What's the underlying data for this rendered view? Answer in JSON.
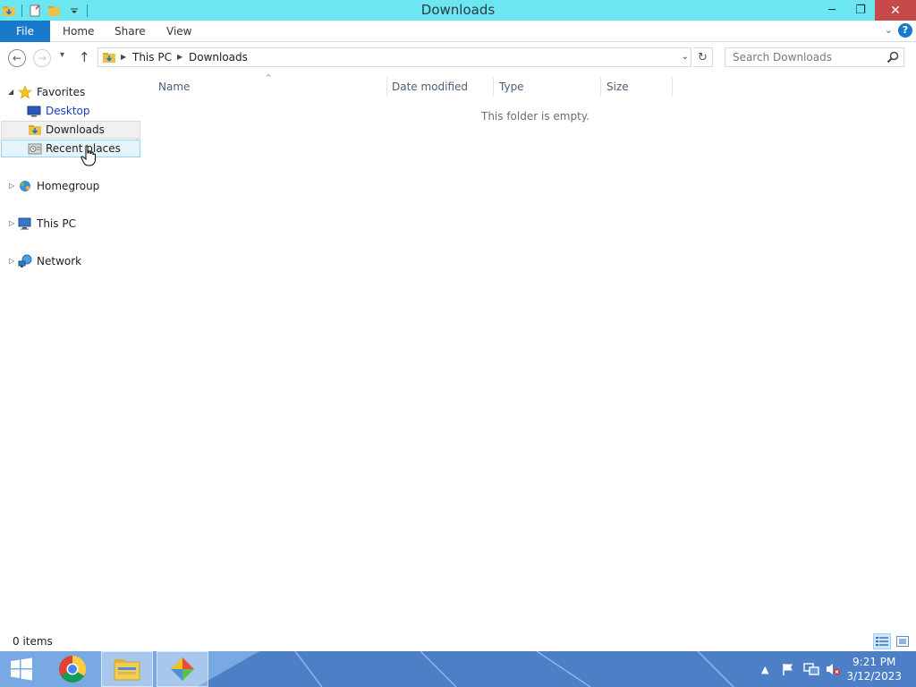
{
  "window": {
    "title": "Downloads",
    "controls": {
      "minimize": "─",
      "restore": "❐",
      "close": "✕"
    }
  },
  "ribbon": {
    "tabs": [
      "File",
      "Home",
      "Share",
      "View"
    ],
    "expand_caret": "⌄",
    "help": "?"
  },
  "nav": {
    "back": "←",
    "forward": "→",
    "recent": "▾",
    "up": "↑",
    "breadcrumb": [
      "This PC",
      "Downloads"
    ],
    "crumb_separator": "▶",
    "address_dropdown": "⌄",
    "refresh": "↻",
    "search_placeholder": "Search Downloads"
  },
  "navpane": {
    "favorites": {
      "label": "Favorites",
      "items": [
        "Desktop",
        "Downloads",
        "Recent places"
      ]
    },
    "homegroup": "Homegroup",
    "this_pc": "This PC",
    "network": "Network",
    "expanded_arrow": "◢",
    "collapsed_arrow": "▷"
  },
  "content": {
    "columns": [
      "Name",
      "Date modified",
      "Type",
      "Size"
    ],
    "sort_indicator": "^",
    "empty_message": "This folder is empty."
  },
  "status": {
    "item_count": "0 items"
  },
  "taskbar": {
    "clock_time": "9:21 PM",
    "clock_date": "3/12/2023",
    "tray_expand": "▲"
  },
  "colors": {
    "titlebar": "#6ce6f0",
    "file_tab": "#1979ca",
    "close_button": "#c74a4a",
    "taskbar": "#6a9bd8",
    "hover": "#e5f3fb"
  }
}
